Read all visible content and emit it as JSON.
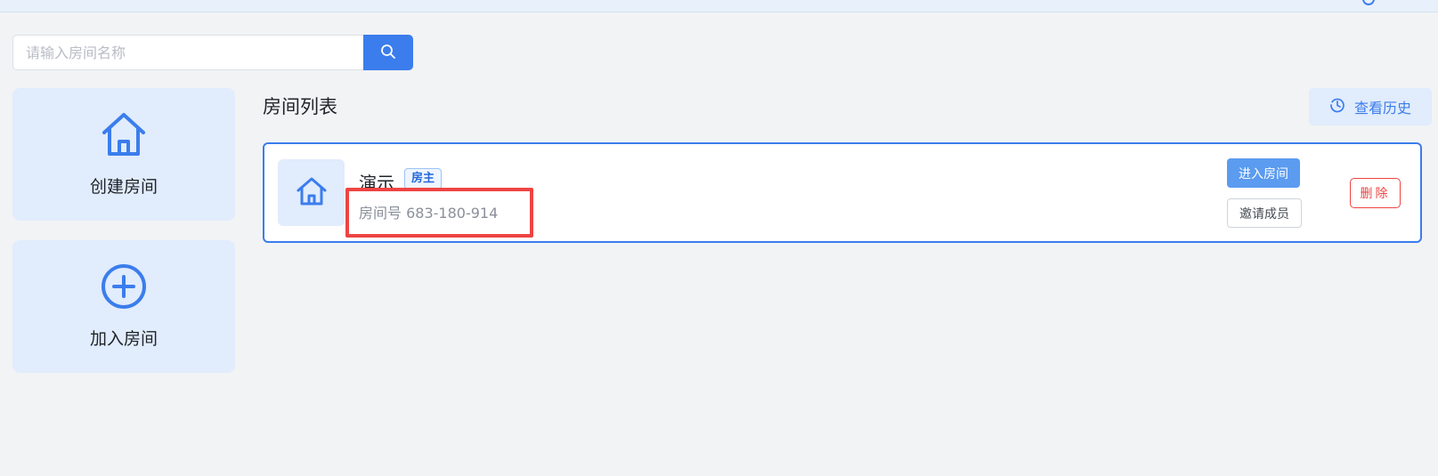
{
  "search": {
    "placeholder": "请输入房间名称",
    "value": ""
  },
  "sidebar": {
    "create_label": "创建房间",
    "join_label": "加入房间"
  },
  "main": {
    "title": "房间列表",
    "history_label": "查看历史",
    "rooms": [
      {
        "name": "演示",
        "role_tag": "房主",
        "room_number": "房间号 683-180-914",
        "enter_label": "进入房间",
        "invite_label": "邀请成员",
        "delete_label": "删除"
      }
    ]
  },
  "colors": {
    "accent": "#3b7ded",
    "card_bg": "#e1ecfc",
    "danger": "#ef4444",
    "highlight": "#ef4444"
  }
}
